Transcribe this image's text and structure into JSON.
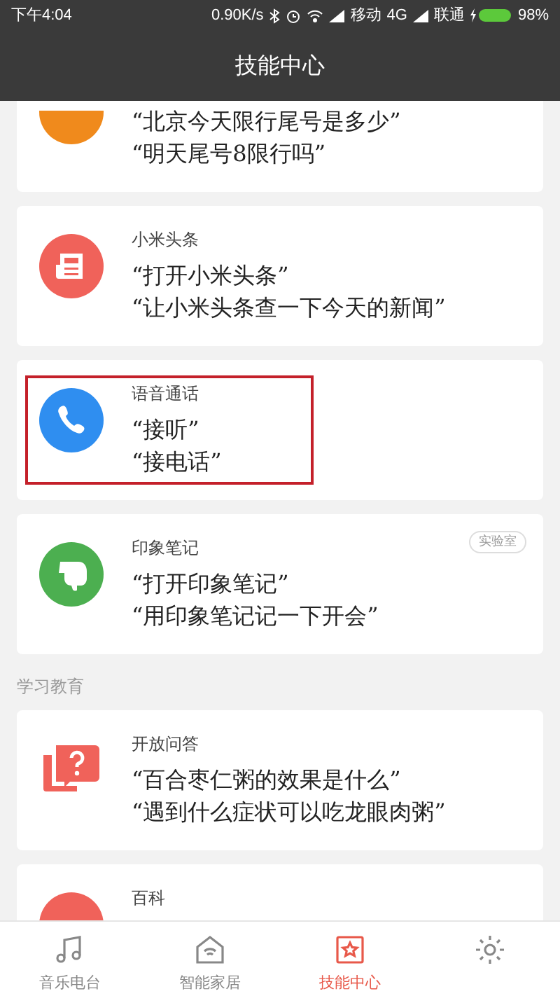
{
  "status_bar": {
    "time": "下午4:04",
    "speed": "0.90K/s",
    "carrier_1": "移动",
    "network": "4G",
    "carrier_2": "联通",
    "battery": "98%"
  },
  "header": {
    "title": "技能中心"
  },
  "sections": [
    {
      "cards": [
        {
          "examples": [
            "“北京今天限行尾号是多少”",
            "“明天尾号8限行吗”"
          ],
          "highlighted": false
        },
        {
          "title": "小米头条",
          "examples": [
            "“打开小米头条”",
            "“让小米头条查一下今天的新闻”"
          ],
          "highlighted": false
        },
        {
          "title": "语音通话",
          "examples": [
            "“接听”",
            "“接电话”"
          ],
          "highlighted": true
        },
        {
          "title": "印象笔记",
          "badge": "实验室",
          "examples": [
            "“打开印象笔记”",
            "“用印象笔记记一下开会”"
          ],
          "highlighted": false
        }
      ]
    },
    {
      "label": "学习教育",
      "cards": [
        {
          "title": "开放问答",
          "examples": [
            "“百合枣仁粥的效果是什么”",
            "“遇到什么症状可以吃龙眼肉粥”"
          ],
          "highlighted": false
        },
        {
          "title": "百科"
        }
      ]
    }
  ],
  "tabs": [
    {
      "label": "音乐电台",
      "selected": false
    },
    {
      "label": "智能家居",
      "selected": false
    },
    {
      "label": "技能中心",
      "selected": true
    },
    {
      "selected": false
    }
  ]
}
